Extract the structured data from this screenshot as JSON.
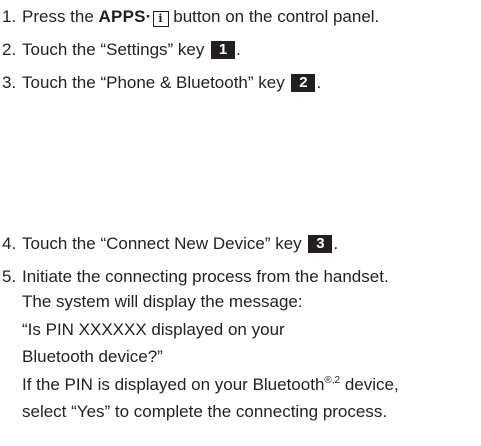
{
  "steps": [
    {
      "number": "1.",
      "pre": "Press the ",
      "button_label": "APPS·",
      "icon_glyph": "i",
      "post": " button on the control panel."
    },
    {
      "number": "2.",
      "pre": "Touch the “Settings” key ",
      "key_number": "1",
      "post": "."
    },
    {
      "number": "3.",
      "pre": "Touch the “Phone & Bluetooth” key ",
      "key_number": "2",
      "post": "."
    },
    {
      "number": "4.",
      "pre": "Touch the “Connect New Device” key ",
      "key_number": "3",
      "post": "."
    },
    {
      "number": "5.",
      "line1": "Initiate the connecting process from the handset.",
      "line2": "The system will display the message:",
      "line3": "“Is PIN XXXXXX displayed on your",
      "line4": "Bluetooth device?”",
      "line5_pre": "If the PIN is displayed on your Bluetooth",
      "line5_sup": "®,2",
      "line5_post": " device,",
      "line6": "select “Yes” to complete the connecting process."
    }
  ]
}
